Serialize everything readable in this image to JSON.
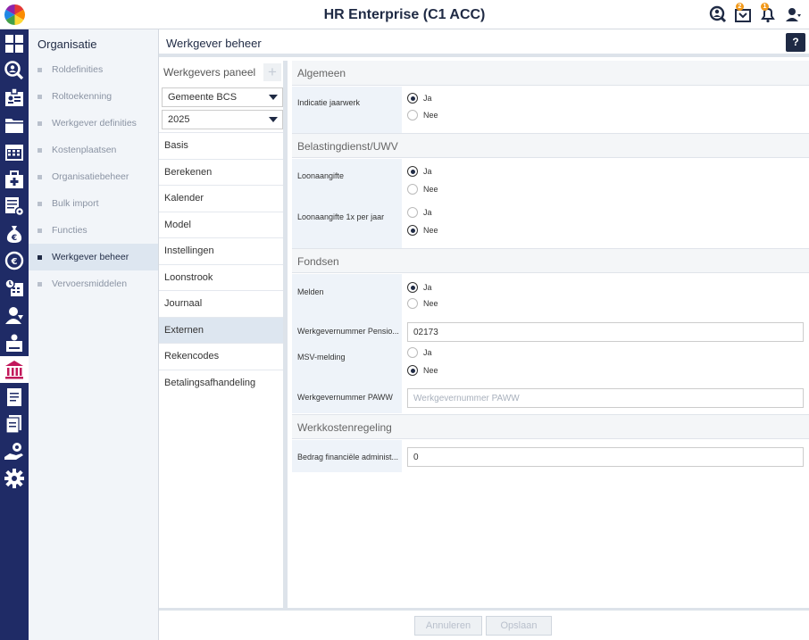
{
  "app": {
    "title": "HR Enterprise (C1 ACC)"
  },
  "topbar": {
    "notification_badge_1": "2",
    "notification_badge_2": "1"
  },
  "nav": {
    "header": "Organisatie",
    "items": [
      {
        "label": "Roldefinities"
      },
      {
        "label": "Roltoekenning"
      },
      {
        "label": "Werkgever definities"
      },
      {
        "label": "Kostenplaatsen"
      },
      {
        "label": "Organisatiebeheer"
      },
      {
        "label": "Bulk import"
      },
      {
        "label": "Functies"
      },
      {
        "label": "Werkgever beheer",
        "active": true
      },
      {
        "label": "Vervoersmiddelen"
      }
    ]
  },
  "page": {
    "title": "Werkgever beheer",
    "help_label": "?"
  },
  "subpanel": {
    "header": "Werkgevers paneel",
    "add_label": "+",
    "employer_select": "Gemeente BCS",
    "year_select": "2025",
    "items": [
      {
        "label": "Basis"
      },
      {
        "label": "Berekenen"
      },
      {
        "label": "Kalender"
      },
      {
        "label": "Model"
      },
      {
        "label": "Instellingen"
      },
      {
        "label": "Loonstrook"
      },
      {
        "label": "Journaal"
      },
      {
        "label": "Externen",
        "active": true
      },
      {
        "label": "Rekencodes"
      },
      {
        "label": "Betalingsafhandeling"
      }
    ]
  },
  "content": {
    "options": {
      "yes": "Ja",
      "no": "Nee"
    },
    "sections": {
      "algemeen": {
        "title": "Algemeen",
        "indicatie_jaarwerk": {
          "label": "Indicatie jaarwerk",
          "value": "Ja"
        }
      },
      "belasting": {
        "title": "Belastingdienst/UWV",
        "loonaangifte": {
          "label": "Loonaangifte",
          "value": "Ja"
        },
        "loonaangifte_1x": {
          "label": "Loonaangifte 1x per jaar",
          "value": "Nee"
        }
      },
      "fondsen": {
        "title": "Fondsen",
        "melden": {
          "label": "Melden",
          "value": "Ja"
        },
        "werkgevernummer_pensioen": {
          "label": "Werkgevernummer Pensio...",
          "value": "02173"
        },
        "msv_melding": {
          "label": "MSV-melding",
          "value": "Nee"
        },
        "werkgevernummer_paww": {
          "label": "Werkgevernummer PAWW",
          "value": "",
          "placeholder": "Werkgevernummer PAWW"
        }
      },
      "werkkosten": {
        "title": "Werkkostenregeling",
        "bedrag": {
          "label": "Bedrag financiële administ...",
          "value": "0"
        }
      }
    }
  },
  "footer": {
    "cancel_label": "Annuleren",
    "save_label": "Opslaan"
  },
  "colors": {
    "sidebar": "#1f2b66",
    "active_icon": "#c2185b",
    "accent": "#1f2a44"
  }
}
